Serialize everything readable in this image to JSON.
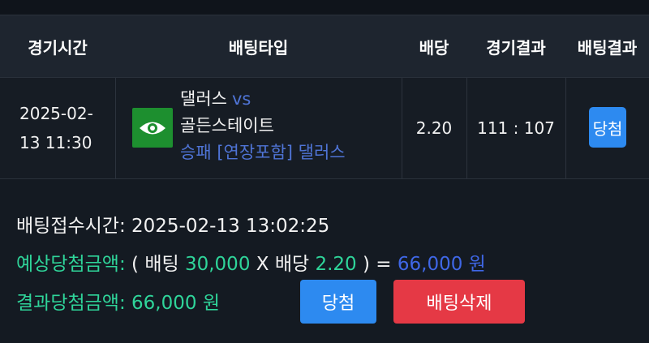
{
  "table": {
    "headers": [
      "경기시간",
      "배팅타입",
      "배당",
      "경기결과",
      "배팅결과"
    ],
    "row": {
      "time_line1": "2025-02-",
      "time_line2": "13 11:30",
      "icon": "eye-icon",
      "home_team": "댈러스",
      "vs": "vs",
      "away_team": "골든스테이트",
      "pick": "승패 [연장포함] 댈러스",
      "odds": "2.20",
      "score": "111 : 107",
      "result_label": "당첨"
    }
  },
  "summary": {
    "receipt_label": "배팅접수시간:",
    "receipt_time": "2025-02-13 13:02:25",
    "expected_label": "예상당첨금액:",
    "open_paren": "(",
    "bet_label": "배팅",
    "bet_amount": "30,000",
    "times": "X",
    "odds_label": "배당",
    "odds_value": "2.20",
    "close_eq": ") =",
    "expected_amount": "66,000 원",
    "result_label": "결과당첨금액:",
    "result_amount": "66,000 원",
    "win_button": "당첨",
    "delete_button": "배팅삭제"
  },
  "colors": {
    "accent_blue": "#2d8af0",
    "danger_red": "#e53945",
    "amount_green": "#2fd59a",
    "link_blue": "#4f74d6"
  }
}
